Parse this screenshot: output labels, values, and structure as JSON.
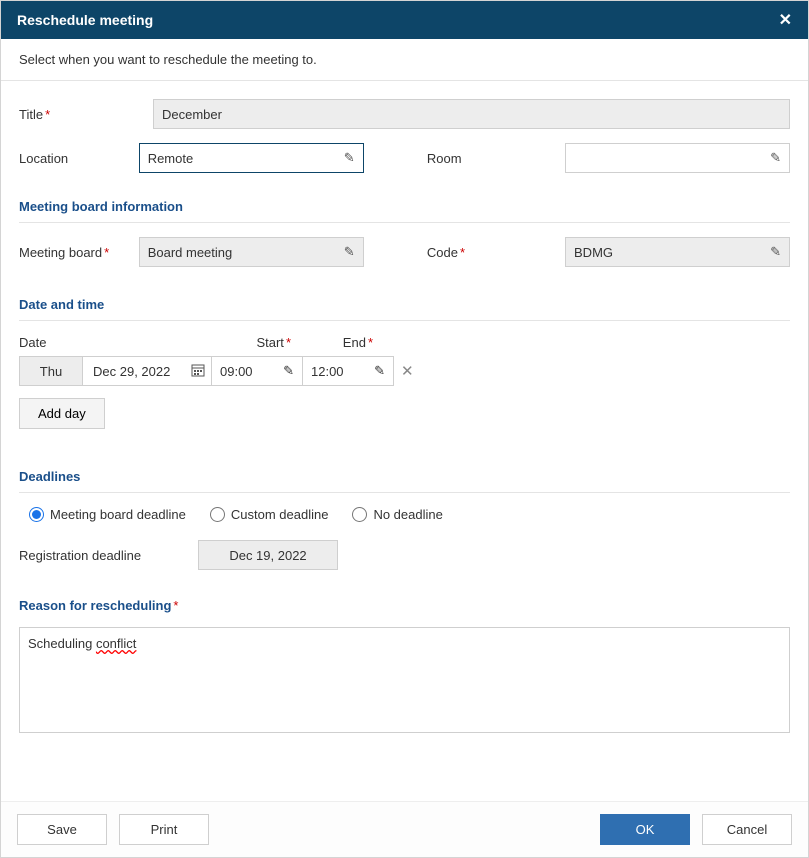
{
  "dialog": {
    "title": "Reschedule meeting",
    "subtitle": "Select when you want to reschedule the meeting to."
  },
  "labels": {
    "title": "Title",
    "location": "Location",
    "room": "Room",
    "meeting_board": "Meeting board",
    "code": "Code",
    "date": "Date",
    "start": "Start",
    "end": "End",
    "add_day": "Add day",
    "reg_deadline": "Registration deadline"
  },
  "sections": {
    "meeting_board_info": "Meeting board information",
    "date_time": "Date and time",
    "deadlines": "Deadlines",
    "reason": "Reason for rescheduling"
  },
  "values": {
    "title": "December",
    "location": "Remote",
    "room": "",
    "meeting_board": "Board meeting",
    "code": "BDMG",
    "day_short": "Thu",
    "date": "Dec 29, 2022",
    "start_time": "09:00",
    "end_time": "12:00",
    "reg_deadline": "Dec 19, 2022",
    "reason_prefix": "Scheduling ",
    "reason_underlined": "conflict"
  },
  "deadlines": {
    "option1": "Meeting board deadline",
    "option2": "Custom deadline",
    "option3": "No deadline"
  },
  "buttons": {
    "save": "Save",
    "print": "Print",
    "ok": "OK",
    "cancel": "Cancel"
  }
}
